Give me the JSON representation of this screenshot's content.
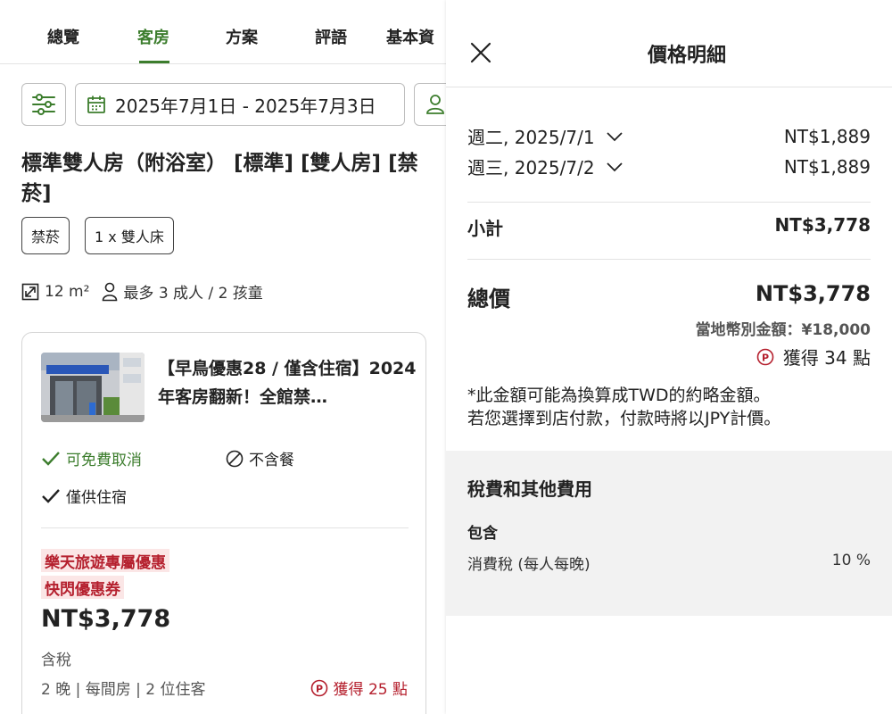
{
  "tabs": [
    {
      "label": "總覽"
    },
    {
      "label": "客房"
    },
    {
      "label": "方案"
    },
    {
      "label": "評語"
    },
    {
      "label": "基本資"
    }
  ],
  "active_tab": "客房",
  "search": {
    "date_range": "2025年7月1日 - 2025年7月3日"
  },
  "room": {
    "title": "標準雙人房（附浴室） [標準] [雙人房] [禁菸]",
    "tags": [
      "禁菸",
      "1 x 雙人床"
    ],
    "size": "12 m²",
    "capacity": "最多 3 成人 / 2 孩童"
  },
  "plan": {
    "name": "【早鳥優惠28 / 僅含住宿】2024年客房翻新！全館禁…",
    "free_cancel": "可免費取消",
    "no_meal": "不含餐",
    "stay_only": "僅供住宿",
    "promo_1": "樂天旅遊專屬優惠",
    "promo_2": "快閃優惠券",
    "price": "NT$3,778",
    "tax_note": "含稅",
    "stay_info": "2 晚 | 每間房 | 2 位住客",
    "points": "獲得 25 點"
  },
  "price_detail": {
    "title": "價格明細",
    "nights": [
      {
        "date": "週二, 2025/7/1",
        "price": "NT$1,889"
      },
      {
        "date": "週三, 2025/7/2",
        "price": "NT$1,889"
      }
    ],
    "subtotal_label": "小計",
    "subtotal": "NT$3,778",
    "total_label": "總價",
    "total": "NT$3,778",
    "local_amount": "當地幣別金額：¥18,000",
    "points": "獲得 34 點",
    "disclaimer_1": "*此金額可能為換算成TWD的約略金額。",
    "disclaimer_2": "若您選擇到店付款，付款時將以JPY計價。",
    "taxes_title": "稅費和其他費用",
    "included_label": "包含",
    "tax_name": "消費稅 (每人每晚)",
    "tax_rate": "10 %"
  },
  "colors": {
    "accent_green": "#3c7d2d",
    "promo_red": "#b5202e",
    "promo_bg": "#fbe6e6"
  }
}
